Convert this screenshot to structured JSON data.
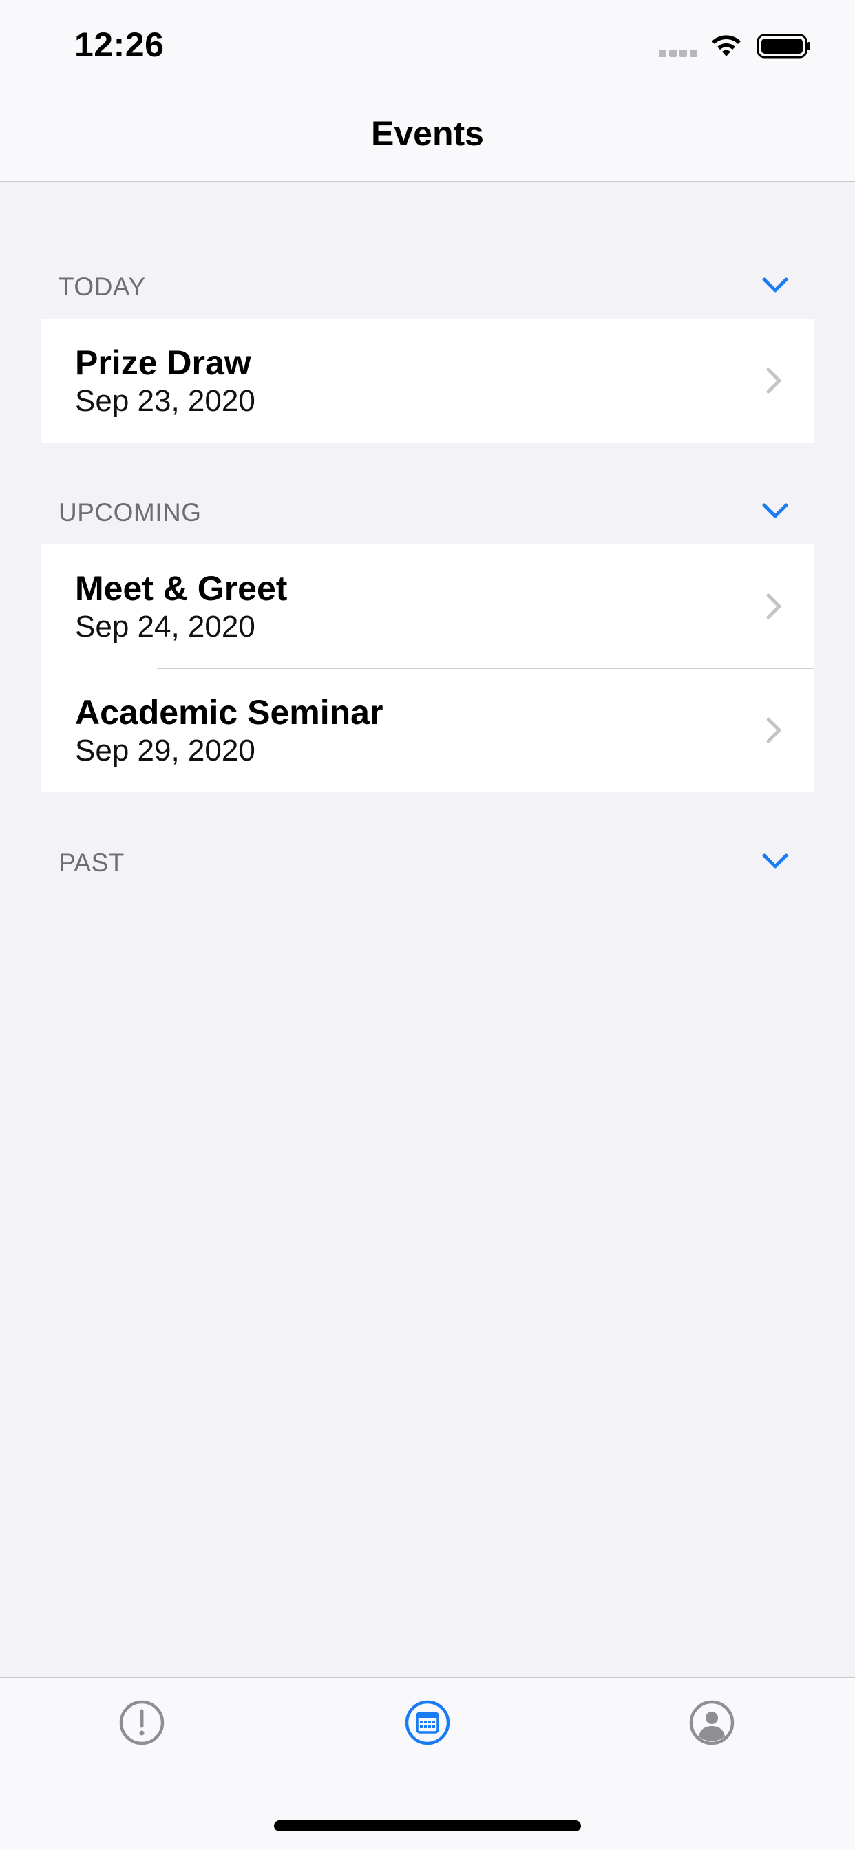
{
  "status_bar": {
    "time": "12:26"
  },
  "nav": {
    "title": "Events"
  },
  "sections": [
    {
      "title": "TODAY",
      "events": [
        {
          "title": "Prize Draw",
          "date": "Sep 23, 2020"
        }
      ]
    },
    {
      "title": "UPCOMING",
      "events": [
        {
          "title": "Meet & Greet",
          "date": "Sep 24, 2020"
        },
        {
          "title": "Academic Seminar",
          "date": "Sep 29, 2020"
        }
      ]
    },
    {
      "title": "PAST",
      "events": []
    }
  ],
  "tab_bar": {
    "tabs": [
      {
        "icon": "exclamation-circle-icon",
        "selected": false
      },
      {
        "icon": "calendar-icon",
        "selected": true
      },
      {
        "icon": "person-circle-icon",
        "selected": false
      }
    ]
  },
  "colors": {
    "accent": "#1a7cf5",
    "inactive_icon": "#8e8e93",
    "background": "#f2f2f7",
    "section_title": "#6d6d72",
    "chevron": "#c4c4c7"
  }
}
